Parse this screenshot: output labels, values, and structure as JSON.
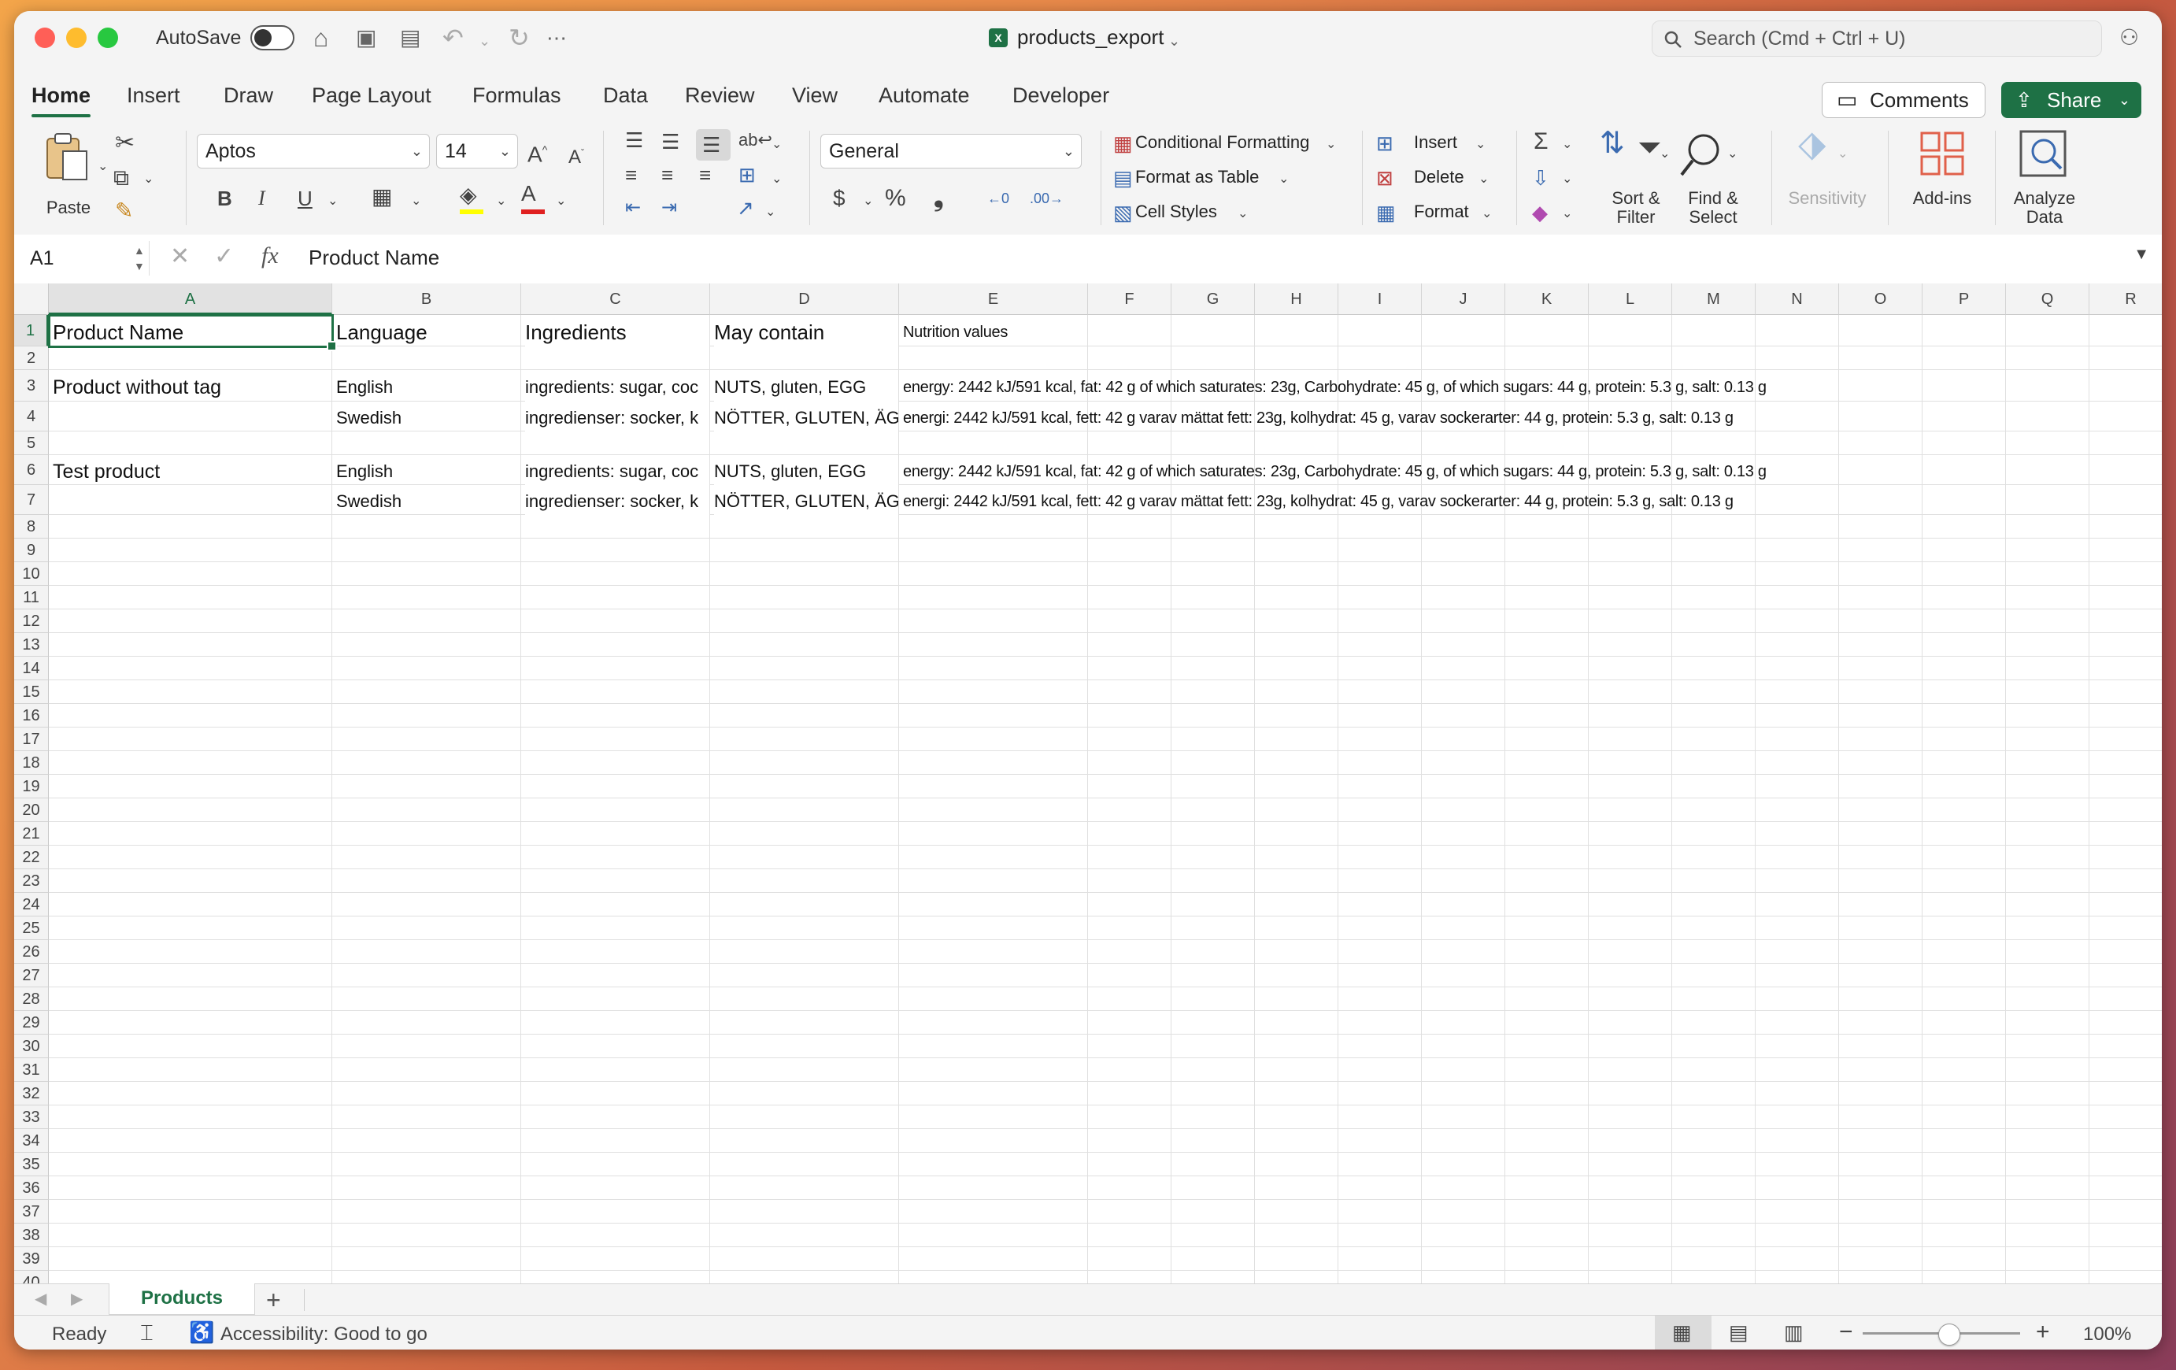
{
  "titlebar": {
    "autosave_label": "AutoSave",
    "doc_title": "products_export",
    "search_placeholder": "Search (Cmd + Ctrl + U)"
  },
  "tabs": [
    "Home",
    "Insert",
    "Draw",
    "Page Layout",
    "Formulas",
    "Data",
    "Review",
    "View",
    "Automate",
    "Developer"
  ],
  "actions": {
    "comments": "Comments",
    "share": "Share"
  },
  "ribbon": {
    "paste": "Paste",
    "font_name": "Aptos",
    "font_size": "14",
    "bold": "B",
    "italic": "I",
    "underline": "U",
    "number_format": "General",
    "conditional_formatting": "Conditional Formatting",
    "format_as_table": "Format as Table",
    "cell_styles": "Cell Styles",
    "insert": "Insert",
    "delete": "Delete",
    "format": "Format",
    "sort_filter": "Sort &",
    "sort_filter2": "Filter",
    "find_select": "Find &",
    "find_select2": "Select",
    "sensitivity": "Sensitivity",
    "add_ins": "Add-ins",
    "analyze_data": "Analyze",
    "analyze_data2": "Data"
  },
  "formula_bar": {
    "name_box": "A1",
    "fx": "fx",
    "formula": "Product Name"
  },
  "columns": [
    "A",
    "B",
    "C",
    "D",
    "E",
    "F",
    "G",
    "H",
    "I",
    "J",
    "K",
    "L",
    "M",
    "N",
    "O",
    "P",
    "Q",
    "R"
  ],
  "rows": [
    "1",
    "2",
    "3",
    "4",
    "5",
    "6",
    "7",
    "8",
    "9",
    "10",
    "11",
    "12",
    "13",
    "14",
    "15",
    "16",
    "17",
    "18",
    "19",
    "20",
    "21",
    "22",
    "23",
    "24",
    "25",
    "26",
    "27",
    "28",
    "29",
    "30",
    "31",
    "32",
    "33",
    "34",
    "35",
    "36",
    "37",
    "38",
    "39",
    "40"
  ],
  "cells": {
    "A1": "Product Name",
    "B1": "Language",
    "C1": "Ingredients",
    "D1": "May contain",
    "E1": "Nutrition values",
    "A3": "Product without tag",
    "B3": "English",
    "C3": "ingredients: sugar, coc",
    "D3": "NUTS, gluten, EGG",
    "E3": "energy: 2442 kJ/591 kcal, fat: 42 g of which saturates: 23g, Carbohydrate: 45 g, of which sugars: 44 g, protein: 5.3 g, salt: 0.13 g",
    "B4": "Swedish",
    "C4": "ingredienser: socker, k",
    "D4": "NÖTTER, GLUTEN, ÄGG",
    "E4": "energi: 2442 kJ/591 kcal, fett: 42 g varav mättat fett: 23g, kolhydrat: 45 g, varav sockerarter: 44 g, protein: 5.3 g, salt: 0.13 g",
    "A6": "Test product",
    "B6": "English",
    "C6": "ingredients: sugar, coc",
    "D6": "NUTS, gluten, EGG",
    "E6": "energy: 2442 kJ/591 kcal, fat: 42 g of which saturates: 23g, Carbohydrate: 45 g, of which sugars: 44 g, protein: 5.3 g, salt: 0.13 g",
    "B7": "Swedish",
    "C7": "ingredienser: socker, k",
    "D7": "NÖTTER, GLUTEN, ÄGG",
    "E7": "energi: 2442 kJ/591 kcal, fett: 42 g varav mättat fett: 23g, kolhydrat: 45 g, varav sockerarter: 44 g, protein: 5.3 g, salt: 0.13 g"
  },
  "sheet": {
    "active_tab": "Products",
    "add": "+"
  },
  "status": {
    "ready": "Ready",
    "accessibility": "Accessibility: Good to go",
    "zoom": "100%"
  },
  "colors": {
    "accent": "#1e7145"
  }
}
